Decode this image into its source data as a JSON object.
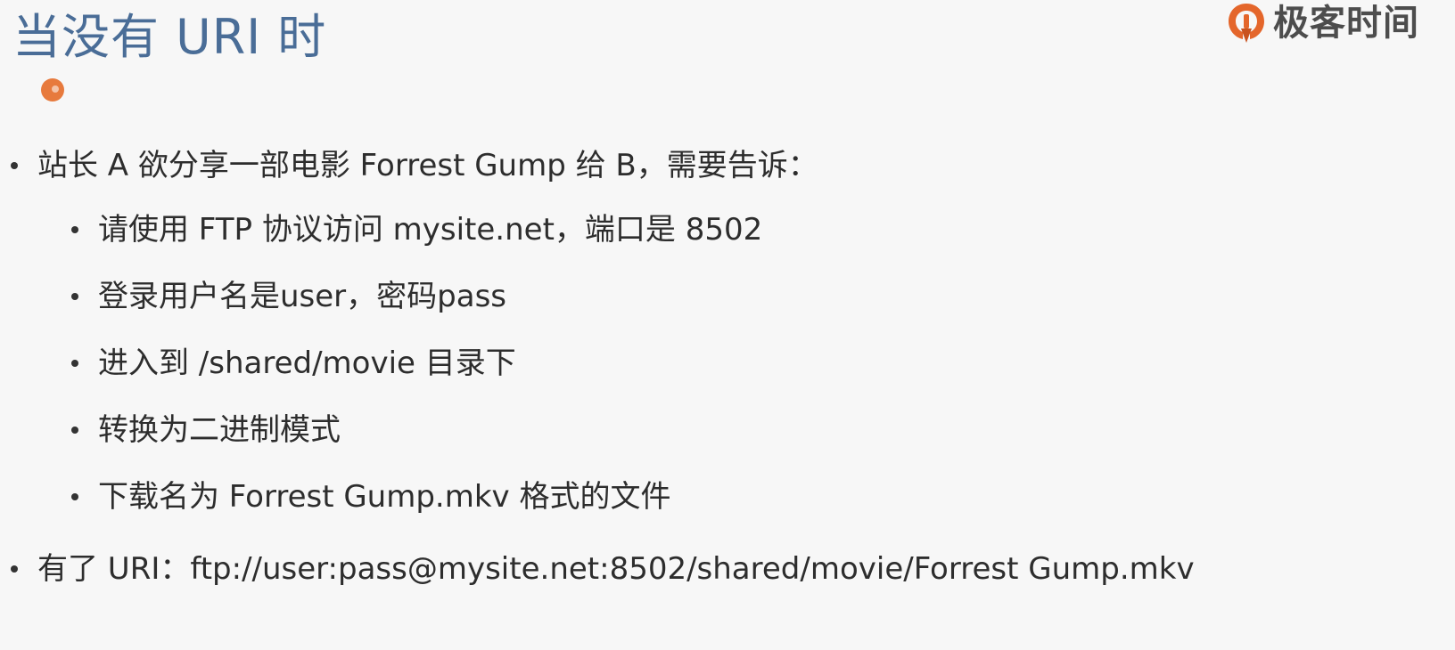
{
  "slide": {
    "title": "当没有 URI 时",
    "logo_text": "极客时间",
    "bullets": [
      {
        "level": 1,
        "text": "站长 A 欲分享一部电影 Forrest Gump 给 B，需要告诉："
      },
      {
        "level": 2,
        "text": "请使用 FTP 协议访问 mysite.net，端口是 8502"
      },
      {
        "level": 2,
        "text": "登录用户名是user，密码pass"
      },
      {
        "level": 2,
        "text": "进入到 /shared/movie 目录下"
      },
      {
        "level": 2,
        "text": "转换为二进制模式"
      },
      {
        "level": 2,
        "text": "下载名为 Forrest Gump.mkv 格式的文件"
      },
      {
        "level": 1,
        "text": "有了 URI：ftp://user:pass@mysite.net:8502/shared/movie/Forrest Gump.mkv"
      }
    ]
  },
  "colors": {
    "title": "#4a6d97",
    "accent": "#e77a3d",
    "text": "#2d2d2d",
    "background": "#f7f7f7"
  },
  "icons": {
    "logo": "geektime-logo-icon",
    "title_marker": "orange-dot-icon"
  }
}
